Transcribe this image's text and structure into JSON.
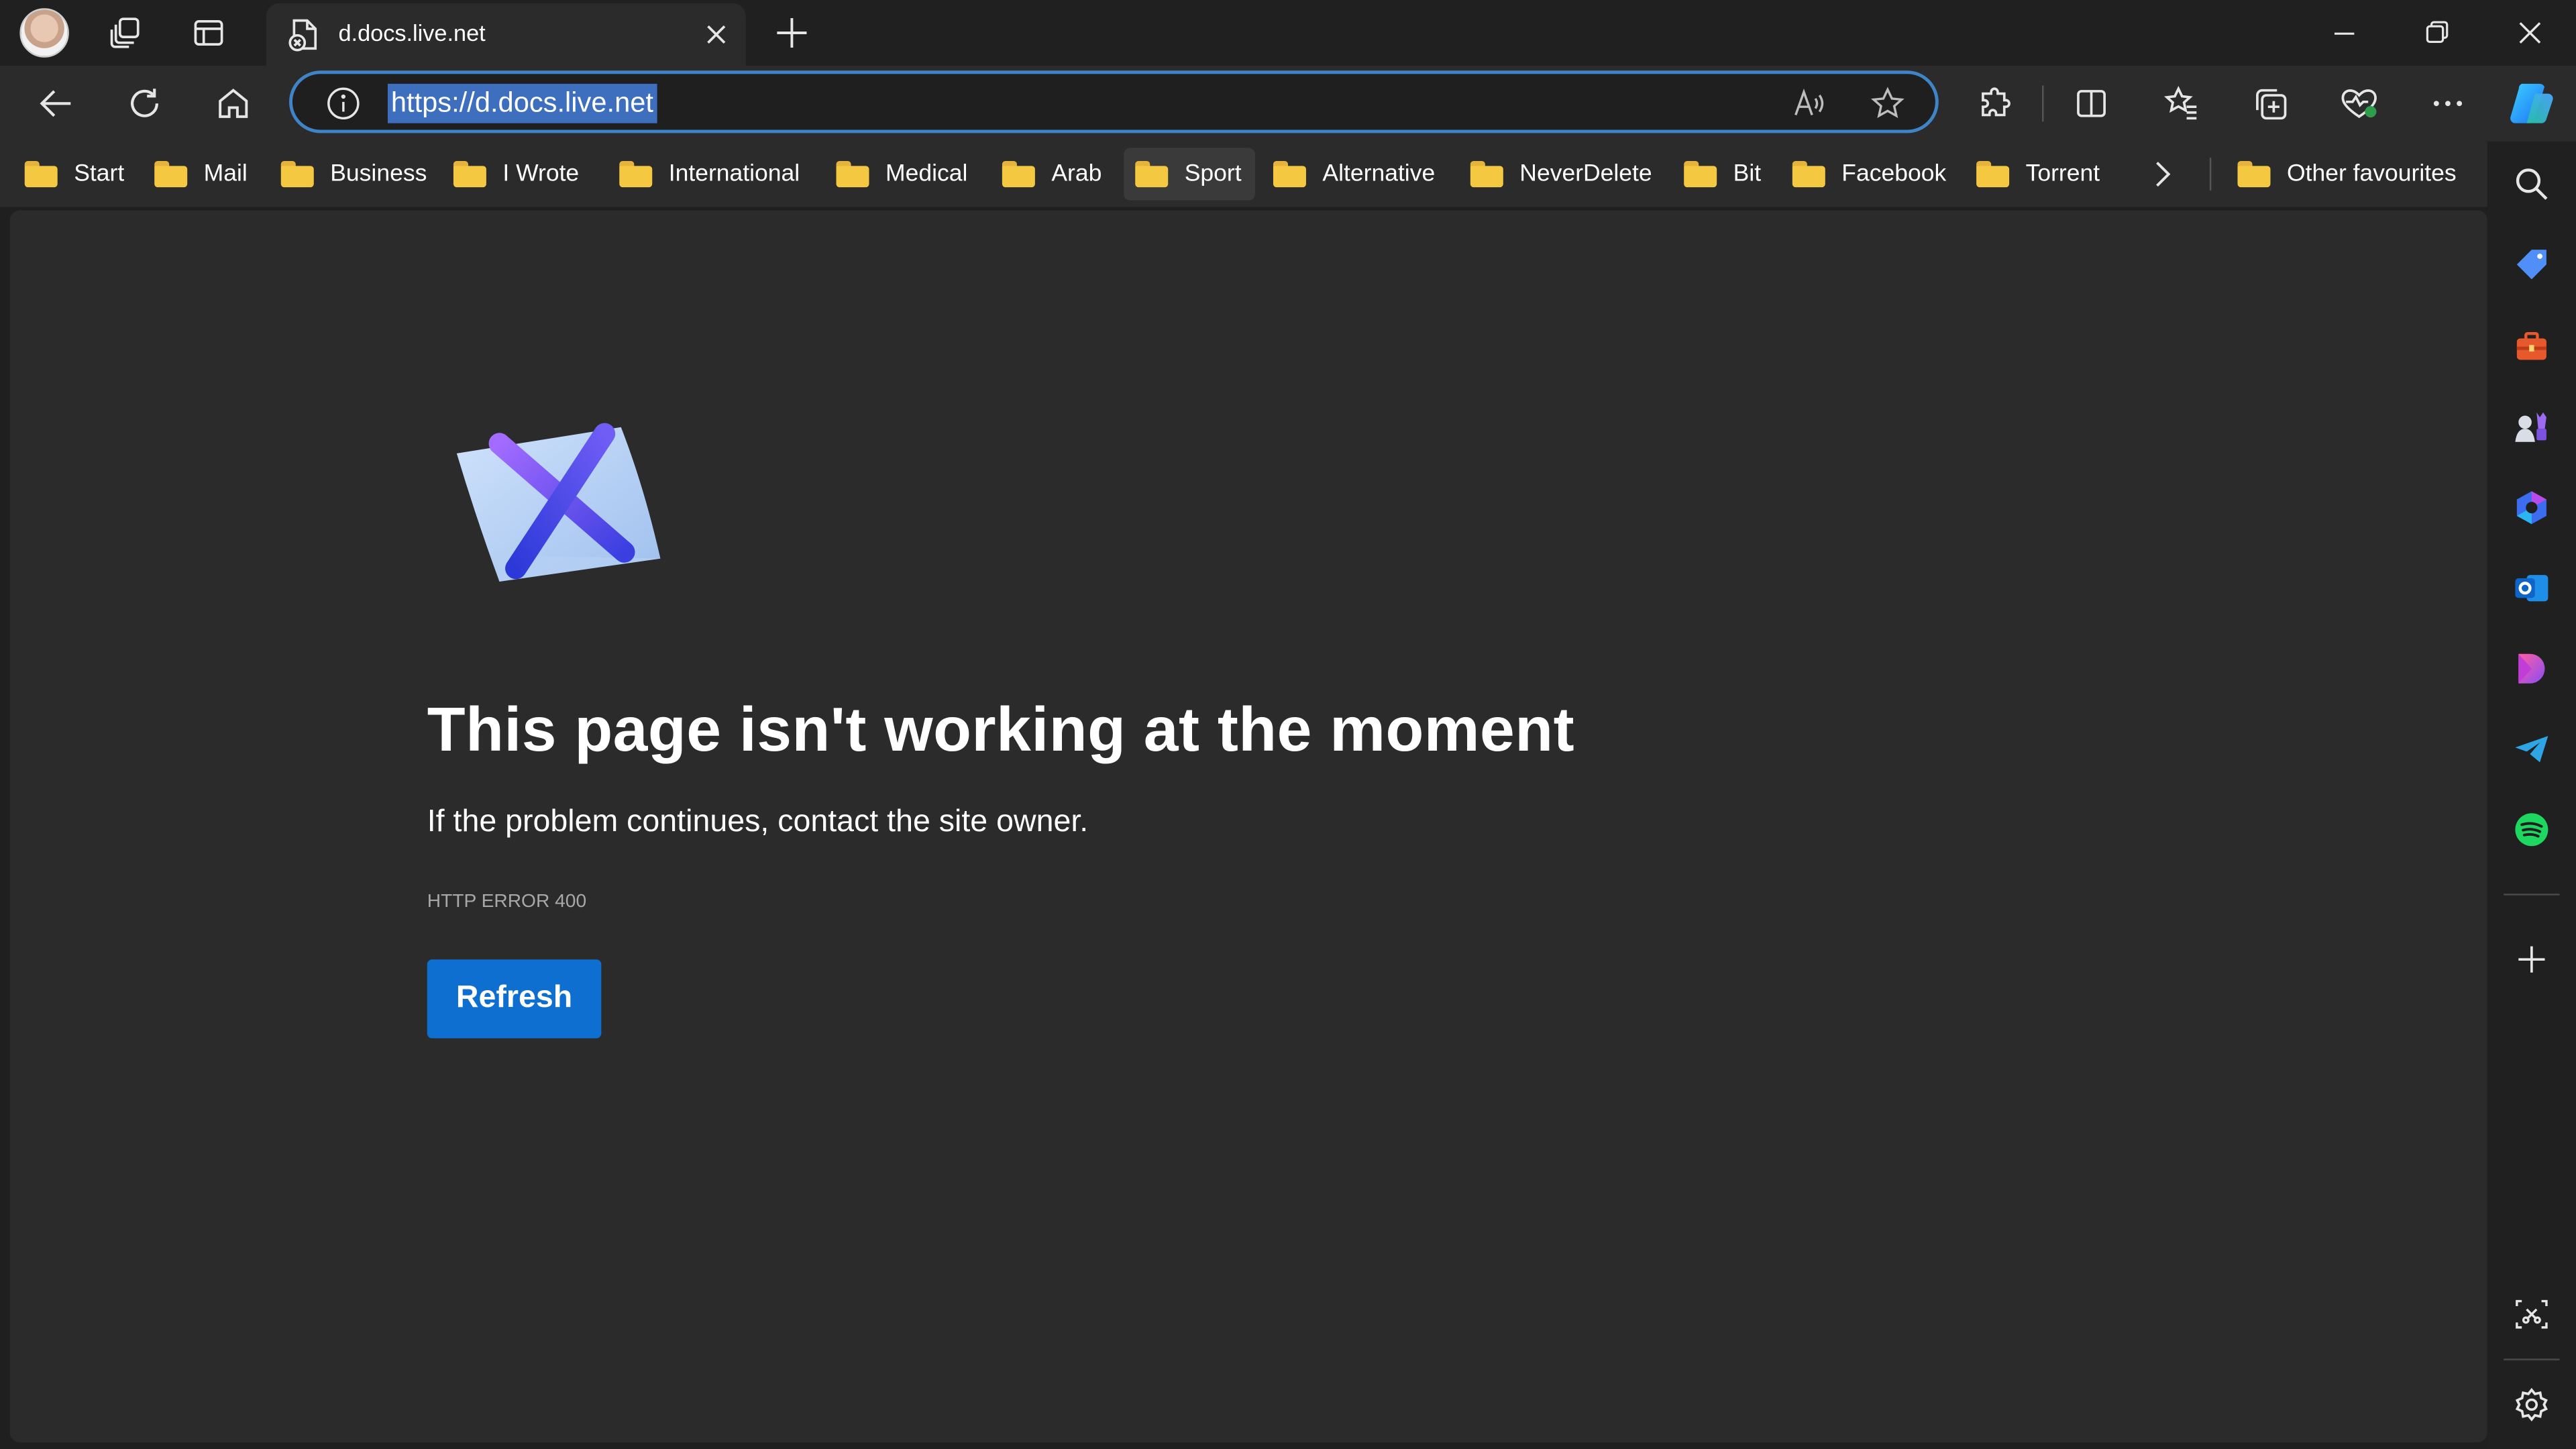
{
  "tab": {
    "title": "d.docs.live.net"
  },
  "address_bar": {
    "url": "https://d.docs.live.net"
  },
  "favourites": {
    "items": [
      {
        "label": "Start"
      },
      {
        "label": "Mail"
      },
      {
        "label": "Business"
      },
      {
        "label": "I Wrote"
      },
      {
        "label": "International"
      },
      {
        "label": "Medical"
      },
      {
        "label": "Arab"
      },
      {
        "label": "Sport"
      },
      {
        "label": "Alternative"
      },
      {
        "label": "NeverDelete"
      },
      {
        "label": "Bit"
      },
      {
        "label": "Facebook"
      },
      {
        "label": "Torrent"
      }
    ],
    "other": "Other favourites",
    "active_item": "Sport"
  },
  "error_page": {
    "title": "This page isn't working at the moment",
    "subtitle": "If the problem continues, contact the site owner.",
    "code": "HTTP ERROR 400",
    "refresh_label": "Refresh"
  },
  "colors": {
    "accent": "#0f6fd0",
    "address_focus": "#3f84c6",
    "selection": "#3e6fbf",
    "folder": "#f5c842",
    "page_background": "#2b2b2b",
    "chrome_background": "#202020"
  },
  "icons": {
    "tabstrip": [
      "profile-avatar",
      "workspaces-icon",
      "tab-actions-icon",
      "broken-page-favicon",
      "close-icon",
      "plus-icon",
      "minimize-icon",
      "restore-icon",
      "window-close-icon"
    ],
    "toolbar": [
      "back-arrow-icon",
      "refresh-icon",
      "home-icon",
      "info-icon",
      "read-aloud-icon",
      "star-icon",
      "extensions-icon",
      "split-screen-icon",
      "favourites-icon",
      "collections-icon",
      "browser-essentials-icon",
      "more-icon",
      "copilot-icon"
    ],
    "sidebar": [
      "search-icon",
      "shopping-tag-icon",
      "tools-icon",
      "games-icon",
      "microsoft-365-icon",
      "outlook-icon",
      "designer-icon",
      "telegram-icon",
      "spotify-icon",
      "add-icon",
      "screenshot-icon",
      "settings-icon"
    ]
  }
}
